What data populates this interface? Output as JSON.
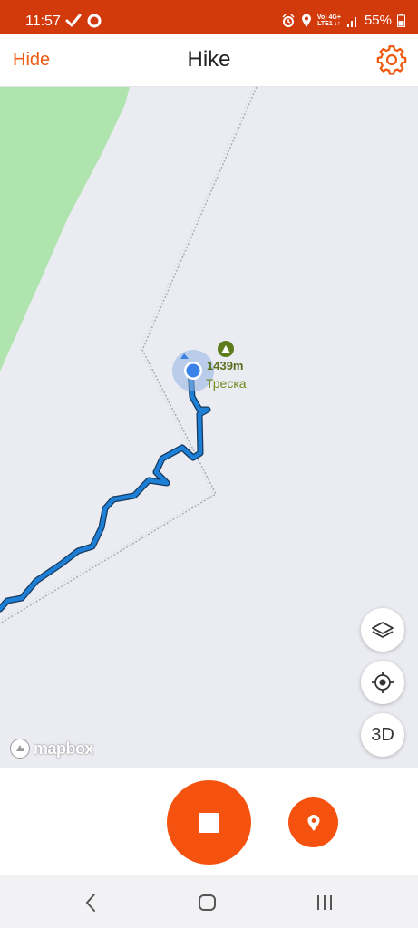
{
  "status_bar": {
    "time": "11:57",
    "battery_percent": "55%",
    "network_label_top": "Vo) 4G+",
    "network_label_bottom": "LTE1 ↓↑",
    "colors": {
      "background": "#d23a0c"
    }
  },
  "app_bar": {
    "hide_label": "Hide",
    "title": "Hike",
    "settings_icon": "gear-icon"
  },
  "map": {
    "peak": {
      "elevation": "1439m",
      "name": "Треска",
      "icon": "mountain-icon"
    },
    "attribution": "mapbox",
    "controls": {
      "layers_icon": "layers-icon",
      "locate_icon": "crosshair-icon",
      "three_d_label": "3D"
    },
    "colors": {
      "track": "#1e7fd6",
      "forest": "#b0e4ae",
      "background": "#ebebf2",
      "peak": "#5d7d1c"
    }
  },
  "actions": {
    "stop_icon": "stop-icon",
    "waypoint_icon": "map-pin-icon",
    "accent": "#f5520f"
  },
  "nav_bar": {
    "back_icon": "back-icon",
    "home_icon": "home-icon",
    "recents_icon": "recents-icon"
  }
}
